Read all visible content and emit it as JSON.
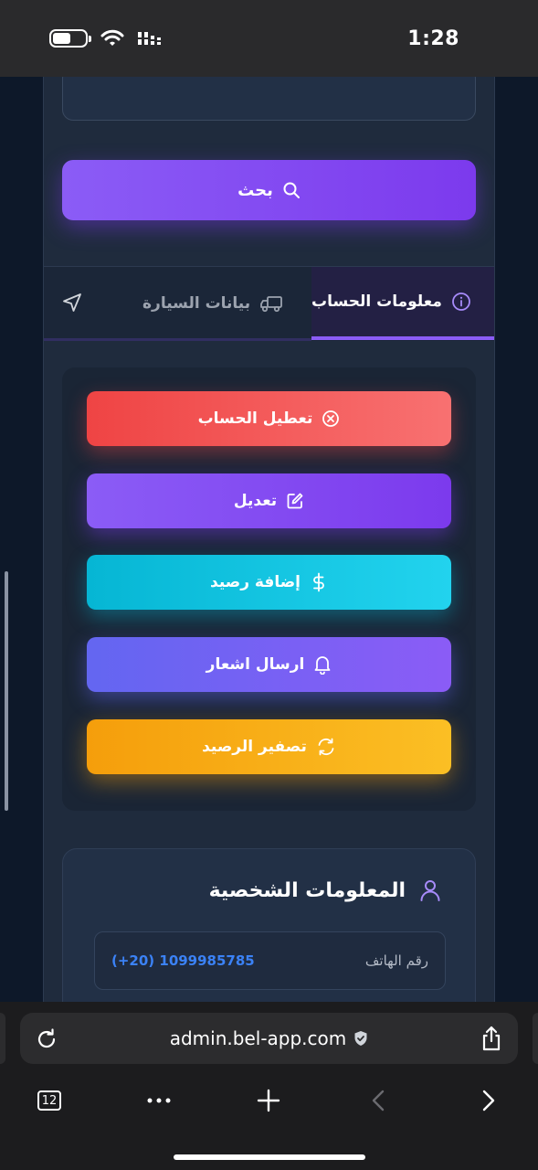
{
  "status_bar": {
    "time": "1:28"
  },
  "search": {
    "button_label": "بحث"
  },
  "tabs": {
    "account_info": "معلومات الحساب",
    "vehicle_data": "بيانات السيارة"
  },
  "actions": {
    "disable_account": "تعطيل الحساب",
    "edit": "تعديل",
    "add_balance": "إضافة رصيد",
    "send_notification": "ارسال اشعار",
    "reset_balance": "تصفير الرصيد"
  },
  "personal_info": {
    "title": "المعلومات الشخصية",
    "phone_label": "رقم الهاتف",
    "phone_value": "(+20) 1099985785"
  },
  "browser": {
    "url": "admin.bel-app.com",
    "tab_count": "12"
  },
  "colors": {
    "accent_purple": "#8b5cf6",
    "danger_red": "#ef4444",
    "info_cyan": "#06b6d4",
    "indigo": "#6366f1",
    "warning_amber": "#f59e0b",
    "link_blue": "#3b82f6"
  }
}
